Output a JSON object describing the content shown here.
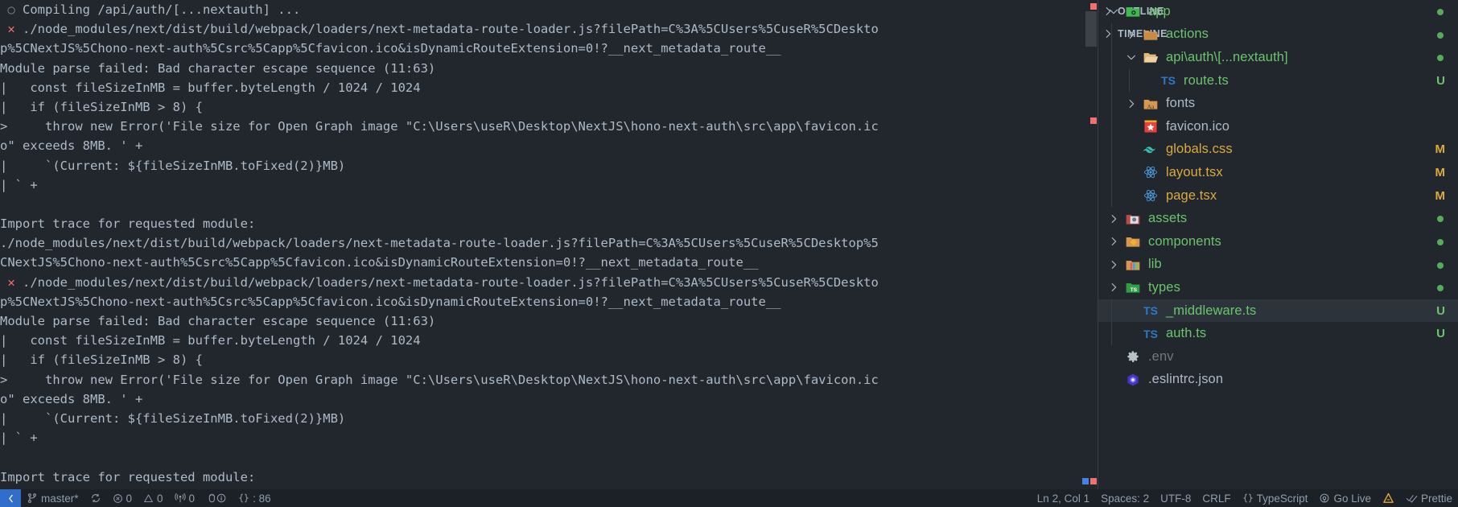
{
  "terminal": {
    "lines": [
      {
        "marker": "circle",
        "text": " Compiling /api/auth/[...nextauth] ..."
      },
      {
        "marker": "error",
        "text": " ./node_modules/next/dist/build/webpack/loaders/next-metadata-route-loader.js?filePath=C%3A%5CUsers%5CuseR%5CDeskto"
      },
      {
        "marker": "none",
        "text": "p%5CNextJS%5Chono-next-auth%5Csrc%5Capp%5Cfavicon.ico&isDynamicRouteExtension=0!?__next_metadata_route__"
      },
      {
        "marker": "none",
        "text": "Module parse failed: Bad character escape sequence (11:63)"
      },
      {
        "marker": "none",
        "text": "|   const fileSizeInMB = buffer.byteLength / 1024 / 1024"
      },
      {
        "marker": "none",
        "text": "|   if (fileSizeInMB > 8) {"
      },
      {
        "marker": "none",
        "text": ">     throw new Error('File size for Open Graph image \"C:\\Users\\useR\\Desktop\\NextJS\\hono-next-auth\\src\\app\\favicon.ic"
      },
      {
        "marker": "none",
        "text": "o\" exceeds 8MB. ' +"
      },
      {
        "marker": "none",
        "text": "|     `(Current: ${fileSizeInMB.toFixed(2)}MB)"
      },
      {
        "marker": "none",
        "text": "| ` +"
      },
      {
        "marker": "none",
        "text": ""
      },
      {
        "marker": "none",
        "text": "Import trace for requested module:"
      },
      {
        "marker": "none",
        "text": "./node_modules/next/dist/build/webpack/loaders/next-metadata-route-loader.js?filePath=C%3A%5CUsers%5CuseR%5CDesktop%5"
      },
      {
        "marker": "none",
        "text": "CNextJS%5Chono-next-auth%5Csrc%5Capp%5Cfavicon.ico&isDynamicRouteExtension=0!?__next_metadata_route__"
      },
      {
        "marker": "error",
        "text": " ./node_modules/next/dist/build/webpack/loaders/next-metadata-route-loader.js?filePath=C%3A%5CUsers%5CuseR%5CDeskto"
      },
      {
        "marker": "none",
        "text": "p%5CNextJS%5Chono-next-auth%5Csrc%5Capp%5Cfavicon.ico&isDynamicRouteExtension=0!?__next_metadata_route__"
      },
      {
        "marker": "none",
        "text": "Module parse failed: Bad character escape sequence (11:63)"
      },
      {
        "marker": "none",
        "text": "|   const fileSizeInMB = buffer.byteLength / 1024 / 1024"
      },
      {
        "marker": "none",
        "text": "|   if (fileSizeInMB > 8) {"
      },
      {
        "marker": "none",
        "text": ">     throw new Error('File size for Open Graph image \"C:\\Users\\useR\\Desktop\\NextJS\\hono-next-auth\\src\\app\\favicon.ic"
      },
      {
        "marker": "none",
        "text": "o\" exceeds 8MB. ' +"
      },
      {
        "marker": "none",
        "text": "|     `(Current: ${fileSizeInMB.toFixed(2)}MB)"
      },
      {
        "marker": "none",
        "text": "| ` +"
      },
      {
        "marker": "none",
        "text": ""
      },
      {
        "marker": "none",
        "text": "Import trace for requested module:"
      }
    ],
    "marker_circle": "○",
    "marker_error": "✕"
  },
  "explorer": {
    "items": [
      {
        "label": "app",
        "icon": "folder-app-icon",
        "indent": 0,
        "chevron": "down",
        "badge": "",
        "dot": true,
        "color": "#6bc46d",
        "selected": false
      },
      {
        "label": "actions",
        "icon": "folder-actions-icon",
        "indent": 1,
        "chevron": "right",
        "badge": "",
        "dot": true,
        "color": "#6bc46d",
        "selected": false
      },
      {
        "label": "api\\auth\\[...nextauth]",
        "icon": "folder-open-icon",
        "indent": 1,
        "chevron": "down",
        "badge": "",
        "dot": true,
        "color": "#6bc46d",
        "selected": false
      },
      {
        "label": "route.ts",
        "icon": "typescript-icon",
        "indent": 2,
        "chevron": "none",
        "badge": "U",
        "dot": false,
        "color": "#6bc46d",
        "selected": false
      },
      {
        "label": "fonts",
        "icon": "folder-fonts-icon",
        "indent": 1,
        "chevron": "right",
        "badge": "",
        "dot": false,
        "color": "#adbac7",
        "selected": false
      },
      {
        "label": "favicon.ico",
        "icon": "favicon-star-icon",
        "indent": 1,
        "chevron": "none",
        "badge": "",
        "dot": false,
        "color": "#adbac7",
        "selected": false
      },
      {
        "label": "globals.css",
        "icon": "tailwind-icon",
        "indent": 1,
        "chevron": "none",
        "badge": "M",
        "dot": false,
        "color": "#daaa3f",
        "selected": false
      },
      {
        "label": "layout.tsx",
        "icon": "react-icon",
        "indent": 1,
        "chevron": "none",
        "badge": "M",
        "dot": false,
        "color": "#daaa3f",
        "selected": false
      },
      {
        "label": "page.tsx",
        "icon": "react-icon",
        "indent": 1,
        "chevron": "none",
        "badge": "M",
        "dot": false,
        "color": "#daaa3f",
        "selected": false
      },
      {
        "label": "assets",
        "icon": "folder-assets-icon",
        "indent": 0,
        "chevron": "right",
        "badge": "",
        "dot": true,
        "color": "#6bc46d",
        "selected": false
      },
      {
        "label": "components",
        "icon": "folder-components-icon",
        "indent": 0,
        "chevron": "right",
        "badge": "",
        "dot": true,
        "color": "#6bc46d",
        "selected": false
      },
      {
        "label": "lib",
        "icon": "folder-lib-icon",
        "indent": 0,
        "chevron": "right",
        "badge": "",
        "dot": true,
        "color": "#6bc46d",
        "selected": false
      },
      {
        "label": "types",
        "icon": "folder-types-icon",
        "indent": 0,
        "chevron": "right",
        "badge": "",
        "dot": true,
        "color": "#6bc46d",
        "selected": false
      },
      {
        "label": "_middleware.ts",
        "icon": "typescript-icon",
        "indent": 1,
        "chevron": "none",
        "badge": "U",
        "dot": false,
        "color": "#6bc46d",
        "selected": true
      },
      {
        "label": "auth.ts",
        "icon": "typescript-icon",
        "indent": 1,
        "chevron": "none",
        "badge": "U",
        "dot": false,
        "color": "#6bc46d",
        "selected": false
      },
      {
        "label": ".env",
        "icon": "gear-icon",
        "indent": 0,
        "chevron": "none",
        "badge": "",
        "dot": false,
        "color": "#6f7782",
        "selected": false
      },
      {
        "label": ".eslintrc.json",
        "icon": "eslint-icon",
        "indent": 0,
        "chevron": "none",
        "badge": "",
        "dot": false,
        "color": "#adbac7",
        "selected": false
      }
    ],
    "sections": [
      {
        "label": "OUTLINE"
      },
      {
        "label": "TIMELINE"
      }
    ],
    "badge_colors": {
      "U": "#6bc46d",
      "M": "#daaa3f"
    }
  },
  "statusbar": {
    "left": [
      {
        "name": "remote-indicator",
        "icon": "remote-icon",
        "label": ""
      },
      {
        "name": "branch",
        "icon": "source-control-icon",
        "label": "master*"
      },
      {
        "name": "sync",
        "icon": "sync-icon",
        "label": ""
      },
      {
        "name": "errors",
        "icon": "error-icon",
        "label": "0"
      },
      {
        "name": "warnings",
        "icon": "warning-icon",
        "label": "0"
      },
      {
        "name": "ports",
        "icon": "radio-tower-icon",
        "label": "0"
      },
      {
        "name": "debug-info",
        "icon": "bug-icon",
        "label": ""
      },
      {
        "name": "format",
        "icon": "braces-icon",
        "label": ": 86"
      }
    ],
    "right": [
      {
        "name": "cursor-position",
        "icon": "",
        "label": "Ln 2, Col 1"
      },
      {
        "name": "indentation",
        "icon": "",
        "label": "Spaces: 2"
      },
      {
        "name": "encoding",
        "icon": "",
        "label": "UTF-8"
      },
      {
        "name": "eol",
        "icon": "",
        "label": "CRLF"
      },
      {
        "name": "language-mode",
        "icon": "braces-icon",
        "label": "TypeScript"
      },
      {
        "name": "go-live",
        "icon": "broadcast-icon",
        "label": "Go Live"
      },
      {
        "name": "nextjs-status",
        "icon": "nextjs-icon",
        "label": ""
      },
      {
        "name": "prettier",
        "icon": "check-icon",
        "label": "Prettie"
      }
    ]
  },
  "colors": {
    "background": "#22272e",
    "statusbar_bg": "#1c2128",
    "selection": "#2d333b",
    "text": "#adbac7",
    "green": "#6bc46d",
    "yellow": "#daaa3f",
    "red": "#f47067",
    "blue": "#316dca",
    "dim": "#6f7782"
  }
}
